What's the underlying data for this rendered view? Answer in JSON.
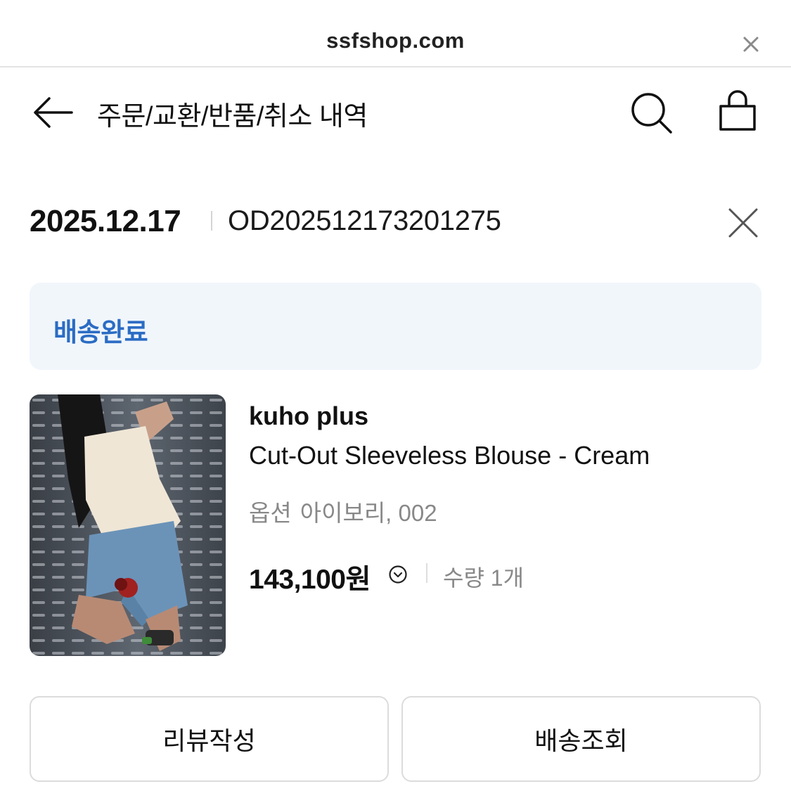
{
  "browser": {
    "url": "ssfshop.com",
    "close_icon": "close-icon"
  },
  "header": {
    "title": "주문/교환/반품/취소 내역",
    "icons": [
      "back-arrow-icon",
      "search-icon",
      "shopping-bag-icon"
    ]
  },
  "order": {
    "date": "2025.12.17",
    "number": "OD202512173201275",
    "delete_icon": "close-icon"
  },
  "status": {
    "label": "배송완료",
    "color": "#2b6cc4",
    "background": "#f1f6fb"
  },
  "product": {
    "brand": "kuho plus",
    "name": "Cut-Out Sleeveless Blouse - Cream",
    "option_label": "옵션",
    "option_value": "아이보리, 002",
    "price": "143,100원",
    "price_detail_icon": "chevron-down-circle-icon",
    "quantity": "수량 1개"
  },
  "actions": {
    "review": "리뷰작성",
    "tracking": "배송조회"
  }
}
